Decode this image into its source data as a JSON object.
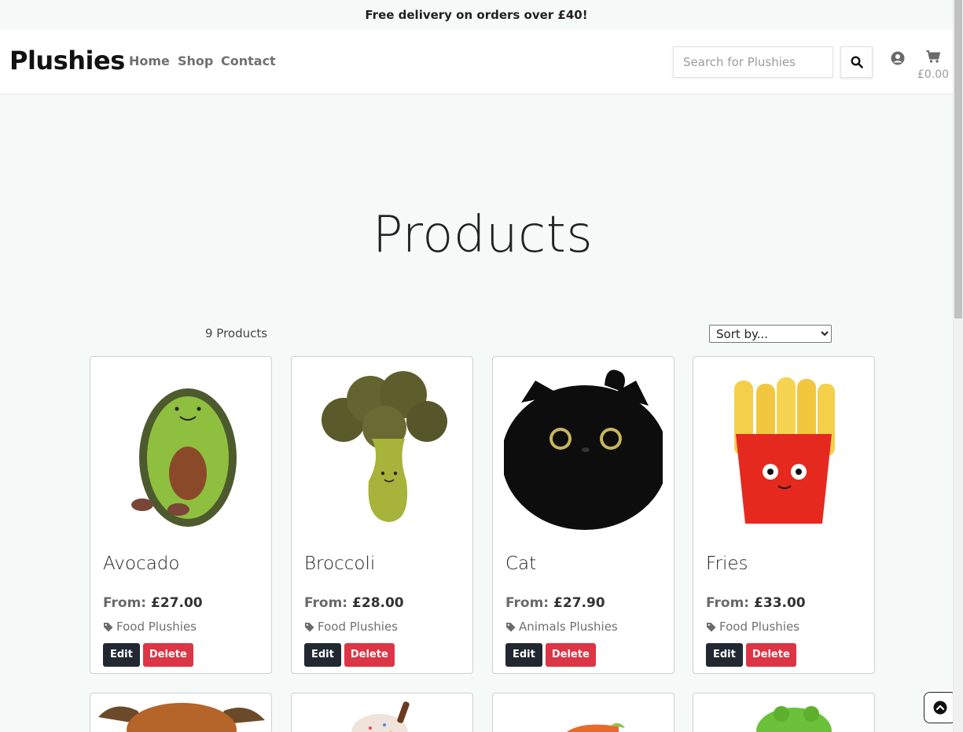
{
  "banner": {
    "text": "Free delivery on orders over £40!"
  },
  "nav": {
    "brand": "Plushies",
    "links": [
      "Home",
      "Shop",
      "Contact"
    ],
    "search_placeholder": "Search for Plushies",
    "search_icon": "search-icon",
    "account_icon": "user-circle-icon",
    "cart_icon": "shopping-cart-icon",
    "cart_total": "£0.00"
  },
  "page": {
    "title": "Products"
  },
  "toolbar": {
    "count": "9 Products",
    "sort_selected": "Sort by..."
  },
  "products": [
    {
      "name": "Avocado",
      "from_label": "From:",
      "price": "£27.00",
      "category": "Food Plushies",
      "edit": "Edit",
      "delete": "Delete"
    },
    {
      "name": "Broccoli",
      "from_label": "From:",
      "price": "£28.00",
      "category": "Food Plushies",
      "edit": "Edit",
      "delete": "Delete"
    },
    {
      "name": "Cat",
      "from_label": "From:",
      "price": "£27.90",
      "category": "Animals Plushies",
      "edit": "Edit",
      "delete": "Delete"
    },
    {
      "name": "Fries",
      "from_label": "From:",
      "price": "£33.00",
      "category": "Food Plushies",
      "edit": "Edit",
      "delete": "Delete"
    }
  ],
  "colors": {
    "accent_dark": "#222831",
    "danger": "#dc3545",
    "page_bg": "#f5faf9"
  },
  "back_to_top_icon": "chevron-up-circle-icon"
}
